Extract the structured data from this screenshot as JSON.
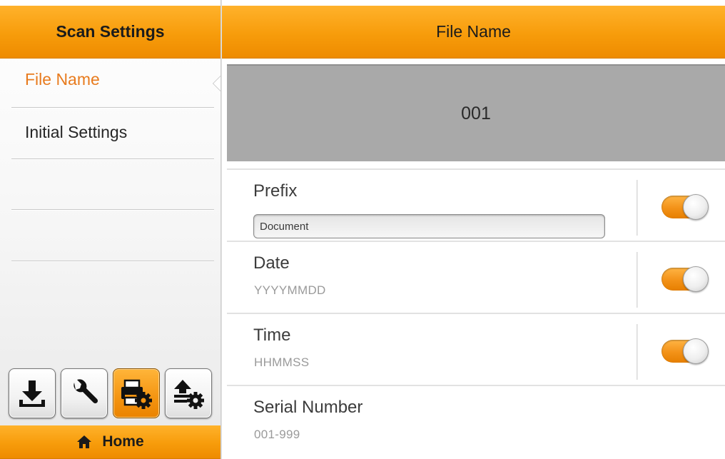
{
  "sidebar": {
    "title": "Scan Settings",
    "items": [
      {
        "label": "File Name",
        "active": true
      },
      {
        "label": "Initial Settings",
        "active": false
      },
      {
        "label": "",
        "active": false
      },
      {
        "label": "",
        "active": false
      },
      {
        "label": "",
        "active": false
      }
    ]
  },
  "toolbar": {
    "buttons": [
      {
        "icon": "download-icon",
        "selected": false
      },
      {
        "icon": "wrench-icon",
        "selected": false
      },
      {
        "icon": "scanner-settings-icon",
        "selected": true
      },
      {
        "icon": "upload-settings-icon",
        "selected": false
      }
    ]
  },
  "home": {
    "label": "Home",
    "icon": "home-icon"
  },
  "main": {
    "title": "File Name",
    "preview": "001",
    "prefix": {
      "label": "Prefix",
      "value": "Document",
      "enabled": true
    },
    "date": {
      "label": "Date",
      "format": "YYYYMMDD",
      "enabled": true
    },
    "time": {
      "label": "Time",
      "format": "HHMMSS",
      "enabled": true
    },
    "serial": {
      "label": "Serial Number",
      "range": "001-999"
    }
  },
  "colors": {
    "accent": "#f79c0b",
    "active_text": "#e87b1e",
    "preview_bg": "#a9a9a9"
  }
}
